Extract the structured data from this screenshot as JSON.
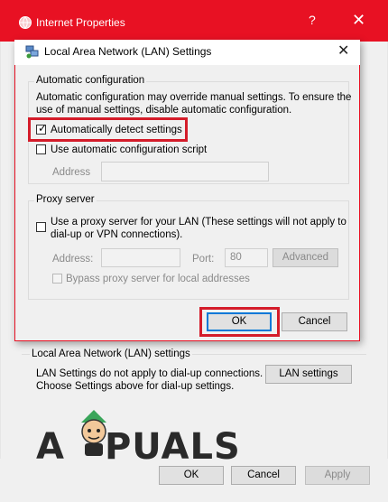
{
  "outer_window": {
    "title": "Internet Properties",
    "help_glyph": "?",
    "close_glyph": "✕",
    "lan_section_label": "Local Area Network (LAN) settings",
    "lan_note_line1": "LAN Settings do not apply to dial-up connections.",
    "lan_note_line2": "Choose Settings above for dial-up settings.",
    "lan_settings_button": "LAN settings",
    "footer": {
      "ok": "OK",
      "cancel": "Cancel",
      "apply": "Apply"
    },
    "title_color": "#e81123"
  },
  "dialog": {
    "title": "Local Area Network (LAN) Settings",
    "close_glyph": "✕",
    "auto_config": {
      "label": "Automatic configuration",
      "desc_line1": "Automatic configuration may override manual settings.  To ensure the",
      "desc_line2": "use of manual settings, disable automatic configuration.",
      "auto_detect": {
        "label": "Automatically detect settings",
        "checked": true
      },
      "use_script": {
        "label": "Use automatic configuration script",
        "checked": false
      },
      "address_label": "Address",
      "address_value": ""
    },
    "proxy": {
      "label": "Proxy server",
      "use_proxy_line1": "Use a proxy server for your LAN (These settings will not apply to",
      "use_proxy_line2": "dial-up or VPN connections).",
      "use_proxy_checked": false,
      "address_label": "Address:",
      "address_value": "",
      "port_label": "Port:",
      "port_value": "80",
      "advanced_button": "Advanced",
      "bypass_label": "Bypass proxy server for local addresses",
      "bypass_checked": false
    },
    "ok_button": "OK",
    "cancel_button": "Cancel"
  },
  "watermark": {
    "text_left": "A",
    "text_right": "PUALS"
  },
  "icons": [
    "network-icon",
    "globe-icon",
    "close-icon",
    "help-icon",
    "checkbox-check-icon",
    "appuals-mascot-icon"
  ]
}
